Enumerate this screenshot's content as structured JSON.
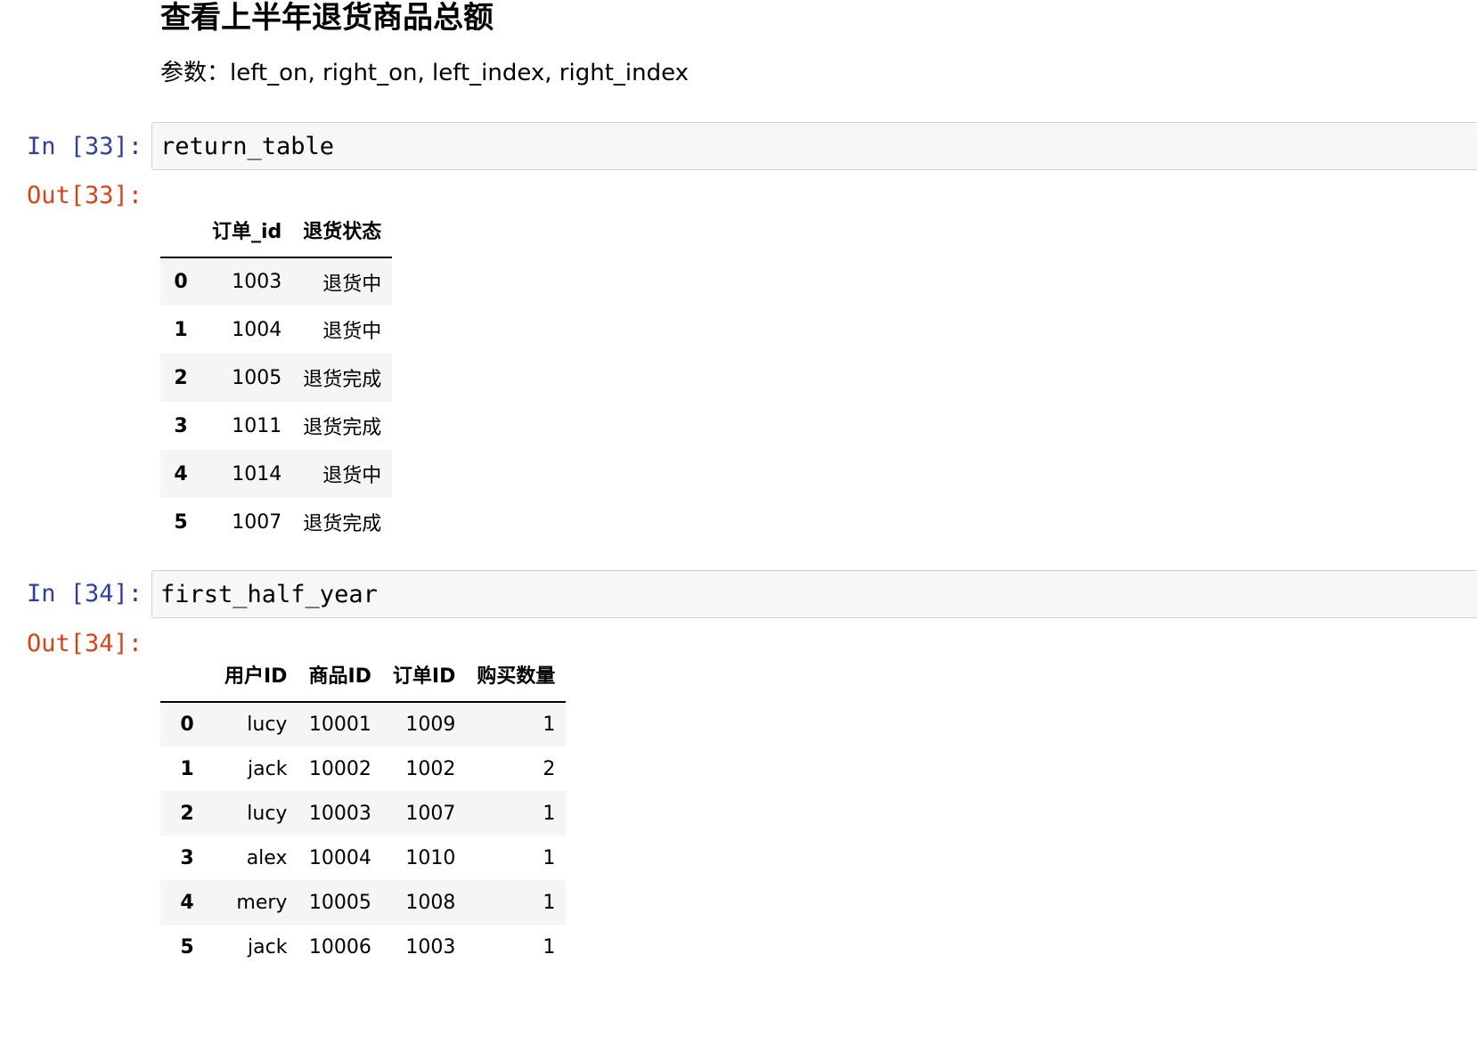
{
  "markdown": {
    "heading": "查看上半年退货商品总额",
    "params": "参数：left_on, right_on, left_index, right_index"
  },
  "cells": [
    {
      "in_prompt": "In [33]:",
      "code": "return_table",
      "out_prompt": "Out[33]:",
      "table": {
        "columns": [
          "订单_id",
          "退货状态"
        ],
        "rows": [
          {
            "index": "0",
            "values": [
              "1003",
              "退货中"
            ]
          },
          {
            "index": "1",
            "values": [
              "1004",
              "退货中"
            ]
          },
          {
            "index": "2",
            "values": [
              "1005",
              "退货完成"
            ]
          },
          {
            "index": "3",
            "values": [
              "1011",
              "退货完成"
            ]
          },
          {
            "index": "4",
            "values": [
              "1014",
              "退货中"
            ]
          },
          {
            "index": "5",
            "values": [
              "1007",
              "退货完成"
            ]
          }
        ]
      }
    },
    {
      "in_prompt": "In [34]:",
      "code": "first_half_year",
      "out_prompt": "Out[34]:",
      "table": {
        "columns": [
          "用户ID",
          "商品ID",
          "订单ID",
          "购买数量"
        ],
        "rows": [
          {
            "index": "0",
            "values": [
              "lucy",
              "10001",
              "1009",
              "1"
            ]
          },
          {
            "index": "1",
            "values": [
              "jack",
              "10002",
              "1002",
              "2"
            ]
          },
          {
            "index": "2",
            "values": [
              "lucy",
              "10003",
              "1007",
              "1"
            ]
          },
          {
            "index": "3",
            "values": [
              "alex",
              "10004",
              "1010",
              "1"
            ]
          },
          {
            "index": "4",
            "values": [
              "mery",
              "10005",
              "1008",
              "1"
            ]
          },
          {
            "index": "5",
            "values": [
              "jack",
              "10006",
              "1003",
              "1"
            ]
          }
        ]
      }
    }
  ]
}
